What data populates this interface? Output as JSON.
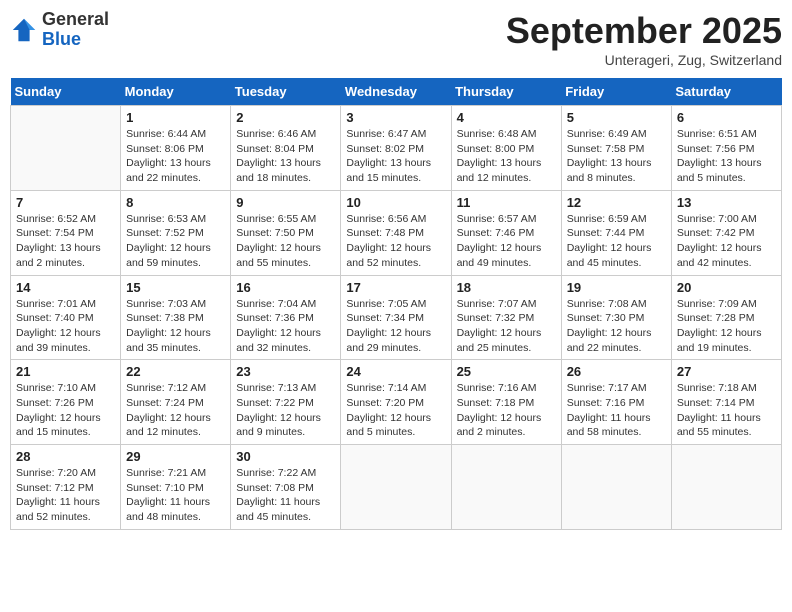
{
  "header": {
    "logo": {
      "general": "General",
      "blue": "Blue"
    },
    "title": "September 2025",
    "location": "Unterageri, Zug, Switzerland"
  },
  "weekdays": [
    "Sunday",
    "Monday",
    "Tuesday",
    "Wednesday",
    "Thursday",
    "Friday",
    "Saturday"
  ],
  "weeks": [
    [
      {
        "day": "",
        "info": ""
      },
      {
        "day": "1",
        "info": "Sunrise: 6:44 AM\nSunset: 8:06 PM\nDaylight: 13 hours and 22 minutes."
      },
      {
        "day": "2",
        "info": "Sunrise: 6:46 AM\nSunset: 8:04 PM\nDaylight: 13 hours and 18 minutes."
      },
      {
        "day": "3",
        "info": "Sunrise: 6:47 AM\nSunset: 8:02 PM\nDaylight: 13 hours and 15 minutes."
      },
      {
        "day": "4",
        "info": "Sunrise: 6:48 AM\nSunset: 8:00 PM\nDaylight: 13 hours and 12 minutes."
      },
      {
        "day": "5",
        "info": "Sunrise: 6:49 AM\nSunset: 7:58 PM\nDaylight: 13 hours and 8 minutes."
      },
      {
        "day": "6",
        "info": "Sunrise: 6:51 AM\nSunset: 7:56 PM\nDaylight: 13 hours and 5 minutes."
      }
    ],
    [
      {
        "day": "7",
        "info": "Sunrise: 6:52 AM\nSunset: 7:54 PM\nDaylight: 13 hours and 2 minutes."
      },
      {
        "day": "8",
        "info": "Sunrise: 6:53 AM\nSunset: 7:52 PM\nDaylight: 12 hours and 59 minutes."
      },
      {
        "day": "9",
        "info": "Sunrise: 6:55 AM\nSunset: 7:50 PM\nDaylight: 12 hours and 55 minutes."
      },
      {
        "day": "10",
        "info": "Sunrise: 6:56 AM\nSunset: 7:48 PM\nDaylight: 12 hours and 52 minutes."
      },
      {
        "day": "11",
        "info": "Sunrise: 6:57 AM\nSunset: 7:46 PM\nDaylight: 12 hours and 49 minutes."
      },
      {
        "day": "12",
        "info": "Sunrise: 6:59 AM\nSunset: 7:44 PM\nDaylight: 12 hours and 45 minutes."
      },
      {
        "day": "13",
        "info": "Sunrise: 7:00 AM\nSunset: 7:42 PM\nDaylight: 12 hours and 42 minutes."
      }
    ],
    [
      {
        "day": "14",
        "info": "Sunrise: 7:01 AM\nSunset: 7:40 PM\nDaylight: 12 hours and 39 minutes."
      },
      {
        "day": "15",
        "info": "Sunrise: 7:03 AM\nSunset: 7:38 PM\nDaylight: 12 hours and 35 minutes."
      },
      {
        "day": "16",
        "info": "Sunrise: 7:04 AM\nSunset: 7:36 PM\nDaylight: 12 hours and 32 minutes."
      },
      {
        "day": "17",
        "info": "Sunrise: 7:05 AM\nSunset: 7:34 PM\nDaylight: 12 hours and 29 minutes."
      },
      {
        "day": "18",
        "info": "Sunrise: 7:07 AM\nSunset: 7:32 PM\nDaylight: 12 hours and 25 minutes."
      },
      {
        "day": "19",
        "info": "Sunrise: 7:08 AM\nSunset: 7:30 PM\nDaylight: 12 hours and 22 minutes."
      },
      {
        "day": "20",
        "info": "Sunrise: 7:09 AM\nSunset: 7:28 PM\nDaylight: 12 hours and 19 minutes."
      }
    ],
    [
      {
        "day": "21",
        "info": "Sunrise: 7:10 AM\nSunset: 7:26 PM\nDaylight: 12 hours and 15 minutes."
      },
      {
        "day": "22",
        "info": "Sunrise: 7:12 AM\nSunset: 7:24 PM\nDaylight: 12 hours and 12 minutes."
      },
      {
        "day": "23",
        "info": "Sunrise: 7:13 AM\nSunset: 7:22 PM\nDaylight: 12 hours and 9 minutes."
      },
      {
        "day": "24",
        "info": "Sunrise: 7:14 AM\nSunset: 7:20 PM\nDaylight: 12 hours and 5 minutes."
      },
      {
        "day": "25",
        "info": "Sunrise: 7:16 AM\nSunset: 7:18 PM\nDaylight: 12 hours and 2 minutes."
      },
      {
        "day": "26",
        "info": "Sunrise: 7:17 AM\nSunset: 7:16 PM\nDaylight: 11 hours and 58 minutes."
      },
      {
        "day": "27",
        "info": "Sunrise: 7:18 AM\nSunset: 7:14 PM\nDaylight: 11 hours and 55 minutes."
      }
    ],
    [
      {
        "day": "28",
        "info": "Sunrise: 7:20 AM\nSunset: 7:12 PM\nDaylight: 11 hours and 52 minutes."
      },
      {
        "day": "29",
        "info": "Sunrise: 7:21 AM\nSunset: 7:10 PM\nDaylight: 11 hours and 48 minutes."
      },
      {
        "day": "30",
        "info": "Sunrise: 7:22 AM\nSunset: 7:08 PM\nDaylight: 11 hours and 45 minutes."
      },
      {
        "day": "",
        "info": ""
      },
      {
        "day": "",
        "info": ""
      },
      {
        "day": "",
        "info": ""
      },
      {
        "day": "",
        "info": ""
      }
    ]
  ]
}
